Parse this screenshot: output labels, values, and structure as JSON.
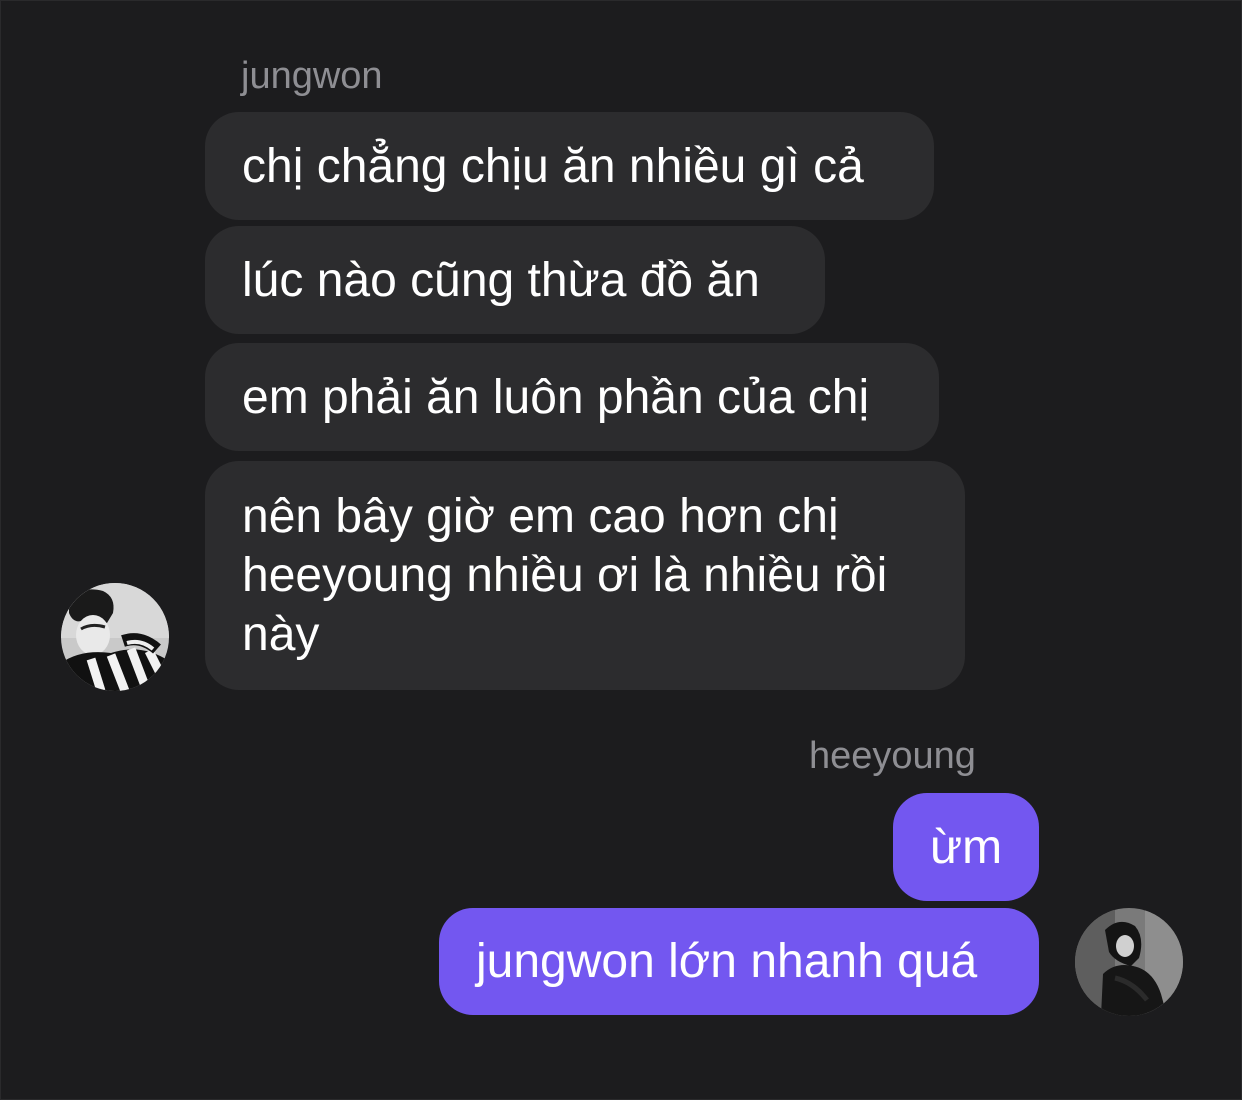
{
  "conversation": {
    "incoming": {
      "sender": "jungwon",
      "messages": [
        {
          "text": "chị chẳng chịu ăn nhiều gì cả"
        },
        {
          "text": "lúc nào cũng thừa đồ ăn"
        },
        {
          "text": "em phải ăn luôn phần của chị"
        },
        {
          "lines": [
            "nên bây giờ em cao hơn chị",
            "heeyoung nhiều ơi là nhiều rồi",
            "này"
          ]
        }
      ],
      "avatar_icon": "profile-photo-jungwon"
    },
    "outgoing": {
      "sender": "heeyoung",
      "messages": [
        {
          "text": "ừm"
        },
        {
          "text": "jungwon lớn nhanh quá"
        }
      ],
      "avatar_icon": "profile-photo-heeyoung"
    }
  },
  "colors": {
    "background": "#1c1c1e",
    "incoming_bubble": "#2c2c2e",
    "outgoing_bubble": "#7357f0",
    "name_text": "#8e8e93",
    "message_text": "#ffffff"
  }
}
